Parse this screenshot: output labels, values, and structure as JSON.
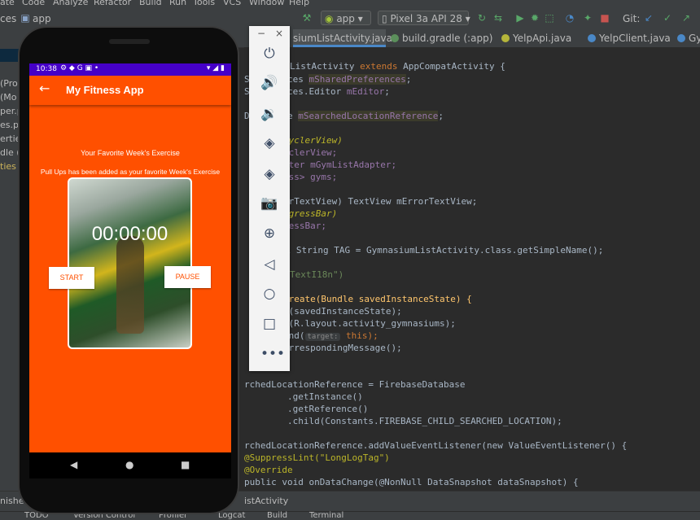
{
  "menu": [
    "ate",
    "Code",
    "Analyze",
    "Refactor",
    "Build",
    "Run",
    "Tools",
    "VCS",
    "Window",
    "Help"
  ],
  "toolbar": {
    "breadcrumb_left": "ces",
    "breadcrumb_app": "app",
    "config": "app",
    "device": "Pixel 3a API 28",
    "git_label": "Git:"
  },
  "tabs": [
    {
      "label": "siumListActivity.java",
      "active": true,
      "color": "#4a88c7"
    },
    {
      "label": "build.gradle (:app)",
      "active": false,
      "color": "#5b8f5b"
    },
    {
      "label": "YelpApi.java",
      "active": false,
      "color": "#b5b53a"
    },
    {
      "label": "YelpClient.java",
      "active": false,
      "color": "#4a88c7"
    },
    {
      "label": "Gy",
      "active": false,
      "color": "#4a88c7"
    }
  ],
  "project": {
    "lines": [
      "(Pro",
      "(Mo",
      "per.p",
      "es.pr",
      "ertie",
      "dle (",
      "ties ("
    ]
  },
  "editor": {
    "lines": [
      {
        "pre": "",
        "a": "ListActivity ",
        "kw": "extends",
        "b": " AppCompatActivity {"
      },
      {
        "pre": "S",
        "a": "references ",
        "fld": "mSharedPreferences",
        "b": ";"
      },
      {
        "pre": "S",
        "a": "references.Editor ",
        "fld": "mEditor",
        "b": ";"
      },
      {
        "pre": "D",
        "a": "eference ",
        "fld": "mSearchedLocationReference",
        "b": ";"
      },
      {
        "pre": "",
        "a": "cyclerView)",
        "kind": "it"
      },
      {
        "pre": "",
        "a": "eclerView;"
      },
      {
        "pre": "",
        "a": "pter mGymListAdapter;"
      },
      {
        "pre": "",
        "a": "ess> gyms;"
      },
      {
        "pre": "",
        "a": "orTextView) TextView mErrorTextView;"
      },
      {
        "pre": "",
        "a": "ogressBar)"
      },
      {
        "pre": "",
        "a": "ressBar;"
      },
      {
        "pre": "",
        "a": "al String TAG = GymnasiumListActivity.class.getSimpleName();"
      },
      {
        "pre": "",
        "a": "TextI18n\")"
      },
      {
        "pre": "",
        "a": "Create(Bundle savedInstanceState) {"
      },
      {
        "pre": "",
        "a": "e(savedInstanceState);"
      },
      {
        "pre": "",
        "a": "w(R.layout.activity_gymnasiums);"
      },
      {
        "pre": "",
        "a": "ind(",
        "hint": "target:",
        "b": " this);"
      },
      {
        "pre": "",
        "a": "orrespondingMessage();"
      },
      {
        "pre": "",
        "a": "rchedLocationReference = FirebaseDatabase"
      },
      {
        "pre": "",
        "a": "        .getInstance()"
      },
      {
        "pre": "",
        "a": "        .getReference()"
      },
      {
        "pre": "",
        "a": "        .child(Constants.FIREBASE_CHILD_SEARCHED_LOCATION);"
      },
      {
        "pre": "",
        "a": "rchedLocationReference.addValueEventListener(new ValueEventListener() {"
      },
      {
        "pre": "",
        "a": "@SuppressLint(\"LongLogTag\")"
      },
      {
        "pre": "",
        "a": "@Override"
      },
      {
        "pre": "",
        "a": "public void onDataChange(@NonNull DataSnapshot dataSnapshot) {"
      }
    ]
  },
  "bottom": {
    "run_label": "nished",
    "activity_label": "istActivity",
    "tools": [
      "TODO",
      "Version Control",
      "Profiler",
      "Logcat",
      "Build",
      "Terminal"
    ]
  },
  "phone": {
    "status_time": "10:38",
    "app_title": "My Fitness App",
    "heading": "Your Favorite Week's Exercise",
    "message": "Pull Ups has been added as your favorite Week's Exercise",
    "timer": "00:00:00",
    "start_label": "START",
    "pause_label": "PAUSE"
  },
  "emulator": {
    "icons": [
      "power-icon",
      "volume-up-icon",
      "volume-down-icon",
      "rotate-left-icon",
      "rotate-right-icon",
      "camera-icon",
      "zoom-icon",
      "back-icon",
      "home-icon",
      "overview-icon",
      "more-icon"
    ]
  }
}
